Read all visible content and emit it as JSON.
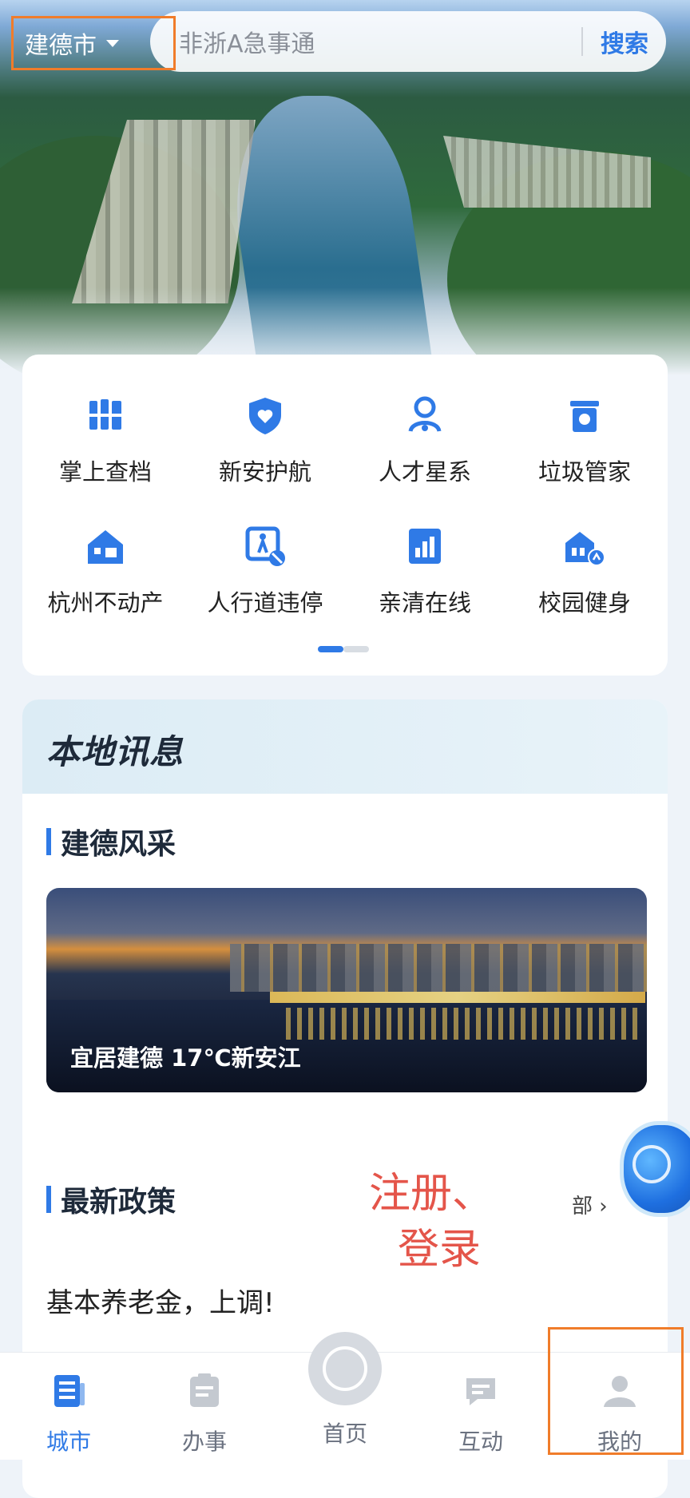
{
  "top_bar": {
    "city": "建德市",
    "search_placeholder": "非浙A急事通",
    "search_button": "搜索"
  },
  "services": [
    {
      "label": "掌上查档",
      "icon": "archive-books-icon"
    },
    {
      "label": "新安护航",
      "icon": "shield-heart-icon"
    },
    {
      "label": "人才星系",
      "icon": "person-network-icon"
    },
    {
      "label": "垃圾管家",
      "icon": "trash-bin-icon"
    },
    {
      "label": "杭州不动产",
      "icon": "house-icon"
    },
    {
      "label": "人行道违停",
      "icon": "pedestrian-no-parking-icon"
    },
    {
      "label": "亲清在线",
      "icon": "building-chart-icon"
    },
    {
      "label": "校园健身",
      "icon": "school-run-icon"
    }
  ],
  "pager": {
    "active": 1,
    "total": 2
  },
  "local_news": {
    "title": "本地讯息",
    "section1": "建德风采",
    "banner_caption": "宜居建德 17℃新安江",
    "section2": "最新政策",
    "more_link": "部 ›",
    "policy_item": "基本养老金，上调!"
  },
  "overlay_note": {
    "line1": "注册、",
    "line2": "登录"
  },
  "tabs": [
    {
      "label": "城市",
      "active": true
    },
    {
      "label": "办事",
      "active": false
    },
    {
      "label": "首页",
      "active": false
    },
    {
      "label": "互动",
      "active": false
    },
    {
      "label": "我的",
      "active": false
    }
  ],
  "colors": {
    "accent": "#2f7ae6",
    "highlight_box": "#f07c2a",
    "note_red": "#e4554a"
  }
}
